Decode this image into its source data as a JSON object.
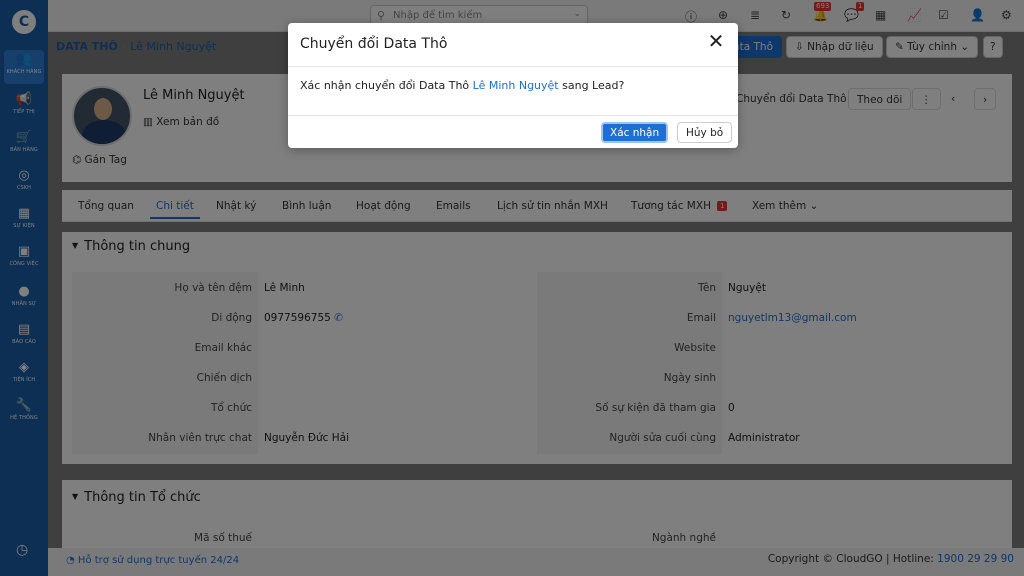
{
  "sidebar": {
    "logo": "C",
    "items": [
      {
        "icon": "users-icon",
        "glyph": "👥",
        "label": "KHÁCH HÀNG"
      },
      {
        "icon": "megaphone-icon",
        "glyph": "📢",
        "label": "TIẾP THỊ"
      },
      {
        "icon": "cart-icon",
        "glyph": "🛒",
        "label": "BÁN HÀNG"
      },
      {
        "icon": "support-icon",
        "glyph": "◎",
        "label": "CSKH"
      },
      {
        "icon": "calendar-icon",
        "glyph": "▦",
        "label": "SỰ KIỆN"
      },
      {
        "icon": "briefcase-icon",
        "glyph": "▣",
        "label": "CÔNG VIỆC"
      },
      {
        "icon": "person-icon",
        "glyph": "●",
        "label": "NHÂN SỰ"
      },
      {
        "icon": "report-icon",
        "glyph": "▤",
        "label": "BÁO CÁO"
      },
      {
        "icon": "tools-icon",
        "glyph": "◈",
        "label": "TIỆN ÍCH"
      },
      {
        "icon": "wrench-icon",
        "glyph": "🔧",
        "label": "HỆ THỐNG"
      }
    ],
    "bottom_icon": "clock-icon"
  },
  "topbar": {
    "search_placeholder": "Nhập để tìm kiếm",
    "notification_count": "693",
    "message_count": "1"
  },
  "breadcrumb": {
    "root": "DATA THÔ",
    "current": "Lê Minh Nguyệt"
  },
  "header_buttons": {
    "primary": "Data Thô",
    "import": "Nhập dữ liệu",
    "customize": "Tùy chỉnh"
  },
  "record": {
    "name": "Lê Minh Nguyệt",
    "map_link": "Xem bản đồ",
    "tag_link": "Gán Tag",
    "convert_button": "Chuyển đổi Data Thô",
    "follow_button": "Theo dõi"
  },
  "tabs": [
    {
      "label": "Tổng quan"
    },
    {
      "label": "Chi tiết",
      "active": true
    },
    {
      "label": "Nhật ký"
    },
    {
      "label": "Bình luận"
    },
    {
      "label": "Hoạt động"
    },
    {
      "label": "Emails"
    },
    {
      "label": "Lịch sử tin nhắn MXH"
    },
    {
      "label": "Tương tác MXH",
      "count": "1"
    },
    {
      "label": "Xem thêm"
    }
  ],
  "section_general": {
    "title": "Thông tin chung",
    "left": [
      {
        "label": "Họ và tên đệm",
        "value": "Lê Minh"
      },
      {
        "label": "Di động",
        "value": "0977596755"
      },
      {
        "label": "Email khác",
        "value": ""
      },
      {
        "label": "Chiến dịch",
        "value": ""
      },
      {
        "label": "Tổ chức",
        "value": ""
      },
      {
        "label": "Nhân viên trực chat",
        "value": "Nguyễn Đức Hải"
      }
    ],
    "right": [
      {
        "label": "Tên",
        "value": "Nguyệt"
      },
      {
        "label": "Email",
        "value": "nguyetlm13@gmail.com"
      },
      {
        "label": "Website",
        "value": ""
      },
      {
        "label": "Ngày sinh",
        "value": ""
      },
      {
        "label": "Số sự kiện đã tham gia",
        "value": "0"
      },
      {
        "label": "Người sửa cuối cùng",
        "value": "Administrator"
      }
    ]
  },
  "section_org": {
    "title": "Thông tin Tổ chức",
    "left_label": "Mã số thuế",
    "right_label": "Ngành nghề"
  },
  "footer": {
    "help": "Hỗ trợ sử dụng trực tuyến 24/24",
    "copyright": "Copyright © CloudGO | Hotline: ",
    "hotline": "1900 29 29 90"
  },
  "modal": {
    "title": "Chuyển đổi Data Thô",
    "message_prefix": "Xác nhận chuyển đổi Data Thô ",
    "message_name": "Lê Minh Nguyệt",
    "message_suffix": " sang Lead?",
    "confirm_label": "Xác nhận",
    "cancel_label": "Hủy bỏ",
    "close_glyph": "✕"
  }
}
